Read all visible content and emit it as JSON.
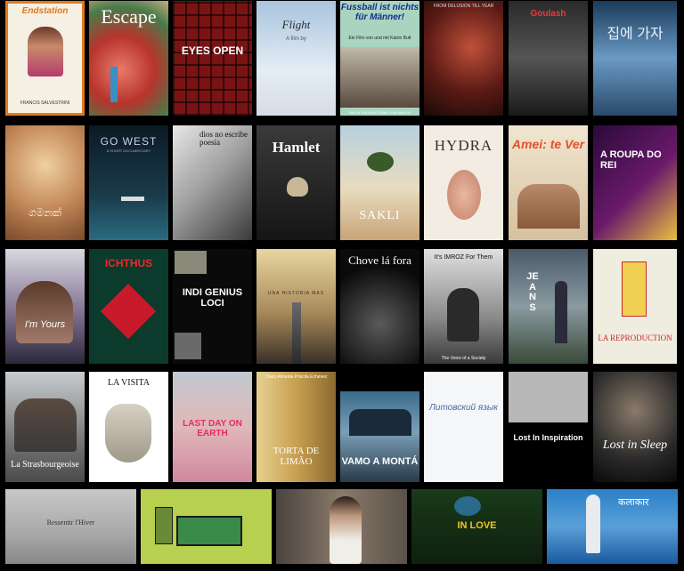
{
  "posters": [
    {
      "title": "Endstation",
      "credit": "FRANCIS SALVESTRINI"
    },
    {
      "title": "Escape"
    },
    {
      "title": "EYES OPEN"
    },
    {
      "title": "Flight",
      "byline": "A film by"
    },
    {
      "title": "Fussball ist nichts für Männer!",
      "subtitle": "Ein Film von und mit Katrin Butt",
      "credit": "JAKOB SUCHENTRUNK    GABI BRUCK"
    },
    {
      "title": "FROM DELUSION TILL YEAR"
    },
    {
      "title": "Goulash"
    },
    {
      "title": "집에 가자"
    },
    {
      "title": "ගමනක්"
    },
    {
      "title": "GO WEST",
      "subtitle": "A SHORT DOCUMENTARY"
    },
    {
      "title": "dios no escribe poesía"
    },
    {
      "title": "Hamlet"
    },
    {
      "title": "SAKLI"
    },
    {
      "title": "HYDRA"
    },
    {
      "title": "Amei: te Ver"
    },
    {
      "title": "A ROUPA DO REI"
    },
    {
      "title": "I'm Yours"
    },
    {
      "title": "ICHTHUS"
    },
    {
      "title": "INDI GENIUS LOCI"
    },
    {
      "title": "UNA HISTORIA MAS"
    },
    {
      "title": "Chove lá fora"
    },
    {
      "title": "It's IMROZ For Them",
      "subtitle": "The Voice of a Society"
    },
    {
      "title": "JEANS"
    },
    {
      "title": "LA REPRODUCTION"
    },
    {
      "title": "La Strasbourgeoise"
    },
    {
      "title": "LA VISITA"
    },
    {
      "title": "LAST DAY ON EARTH"
    },
    {
      "title": "TORTA DE LIMÃO",
      "credit": "Thaís Almeida    Priscila Echevez"
    },
    {
      "title": "VAMO A MONTÁ"
    },
    {
      "title": "Литовский язык"
    },
    {
      "title": "Lost In Inspiration"
    },
    {
      "title": "Lost in Sleep"
    },
    {
      "title": "Ressentir l'Hiver"
    },
    {
      "title": ""
    },
    {
      "title": ""
    },
    {
      "title": "IN LOVE"
    },
    {
      "title": "कलाकार"
    }
  ]
}
